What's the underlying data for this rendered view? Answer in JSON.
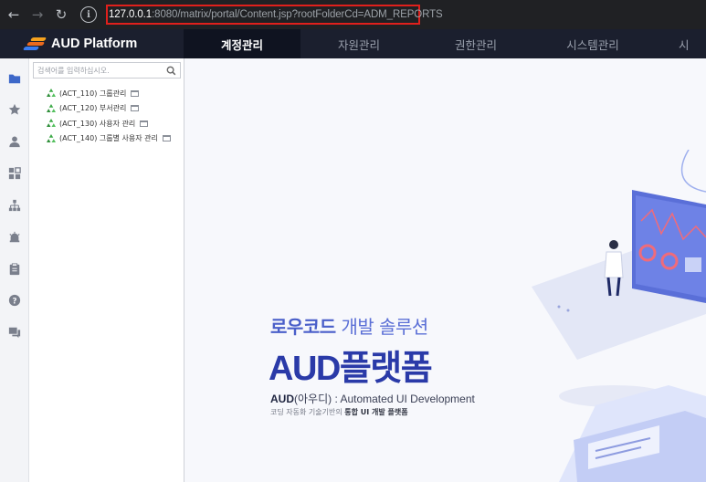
{
  "browser": {
    "url_host": "127.0.0.1",
    "url_rest": ":8080/matrix/portal/Content.jsp?rootFolderCd=ADM_REPORTS"
  },
  "header": {
    "logo_text": "AUD Platform",
    "tabs": [
      {
        "label": "계정관리",
        "active": true
      },
      {
        "label": "자원관리",
        "active": false
      },
      {
        "label": "권한관리",
        "active": false
      },
      {
        "label": "시스템관리",
        "active": false
      },
      {
        "label": "시",
        "active": false
      }
    ]
  },
  "rail_icons": [
    "folder-icon",
    "star-icon",
    "user-icon",
    "dashboard-icon",
    "org-chart-icon",
    "alarm-icon",
    "clipboard-icon",
    "help-icon",
    "chat-icon"
  ],
  "tree": {
    "search_placeholder": "검색어를 입력하십시오.",
    "items": [
      {
        "label": "(ACT_110) 그룹관리"
      },
      {
        "label": "(ACT_120) 부서관리"
      },
      {
        "label": "(ACT_130) 사용자 관리"
      },
      {
        "label": "(ACT_140) 그룹별 사용자 관리"
      }
    ]
  },
  "hero": {
    "sub_bold": "로우코드",
    "sub_light": " 개발 솔루션",
    "title_en": "AUD",
    "title_ko": "플랫폼",
    "desc_bold": "AUD",
    "desc_rest": "(아우디) : Automated UI Development",
    "tag_prefix": "코딩 자동화 기술기반의 ",
    "tag_bold": "통합 UI 개발 플랫폼"
  },
  "colors": {
    "header_bg": "#1b1f2e",
    "accent_blue": "#2a3aa8",
    "url_highlight": "#e0201c"
  }
}
